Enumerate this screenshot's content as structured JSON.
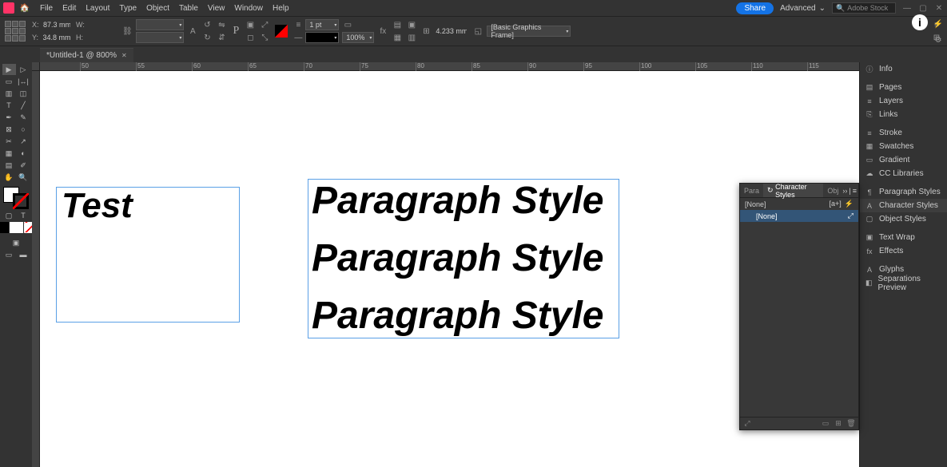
{
  "menubar": {
    "items": [
      "File",
      "Edit",
      "Layout",
      "Type",
      "Object",
      "Table",
      "View",
      "Window",
      "Help"
    ],
    "share": "Share",
    "workspace": "Advanced",
    "search_placeholder": "Adobe Stock"
  },
  "control": {
    "x_label": "X:",
    "x_val": "87.3 mm",
    "y_label": "Y:",
    "y_val": "34.8 mm",
    "w_label": "W:",
    "w_val": "",
    "h_label": "H:",
    "h_val": "",
    "stroke_weight": "1 pt",
    "opacity": "100%",
    "gutter_val": "4.233 mm",
    "object_style": "[Basic Graphics Frame]"
  },
  "document": {
    "tab_title": "*Untitled-1 @ 800%"
  },
  "ruler_ticks": [
    "50",
    "55",
    "60",
    "65",
    "70",
    "75",
    "80",
    "85",
    "90",
    "95",
    "100",
    "105",
    "110",
    "115"
  ],
  "canvas": {
    "frame1_text": "Test",
    "frame2_lines": [
      "Paragraph Style",
      "Paragraph Style",
      "Paragraph Style"
    ]
  },
  "right_rail": {
    "s1": [
      "Info"
    ],
    "s2": [
      "Pages",
      "Layers",
      "Links"
    ],
    "s3": [
      "Stroke",
      "Swatches",
      "Gradient",
      "CC Libraries"
    ],
    "s4": [
      "Paragraph Styles",
      "Character Styles",
      "Object Styles"
    ],
    "s5": [
      "Text Wrap",
      "Effects"
    ],
    "s6": [
      "Glyphs",
      "Separations Preview"
    ]
  },
  "float_panel": {
    "tabs": [
      "Para",
      "Character Styles",
      "Obj"
    ],
    "active_tab": 1,
    "row_header": "[None]",
    "rows": [
      "[None]"
    ]
  },
  "icons": {
    "info": "ⓘ",
    "pages": "▤",
    "layers": "≡",
    "links": "⎘",
    "stroke": "≡",
    "swatches": "▦",
    "gradient": "▭",
    "cc": "☁",
    "parastyles": "¶",
    "charstyles": "A",
    "objstyles": "▢",
    "textwrap": "▣",
    "effects": "fx",
    "glyphs": "A",
    "sep": "◧",
    "sync": "↻",
    "lightning": "⚡",
    "pin": "⤢"
  }
}
